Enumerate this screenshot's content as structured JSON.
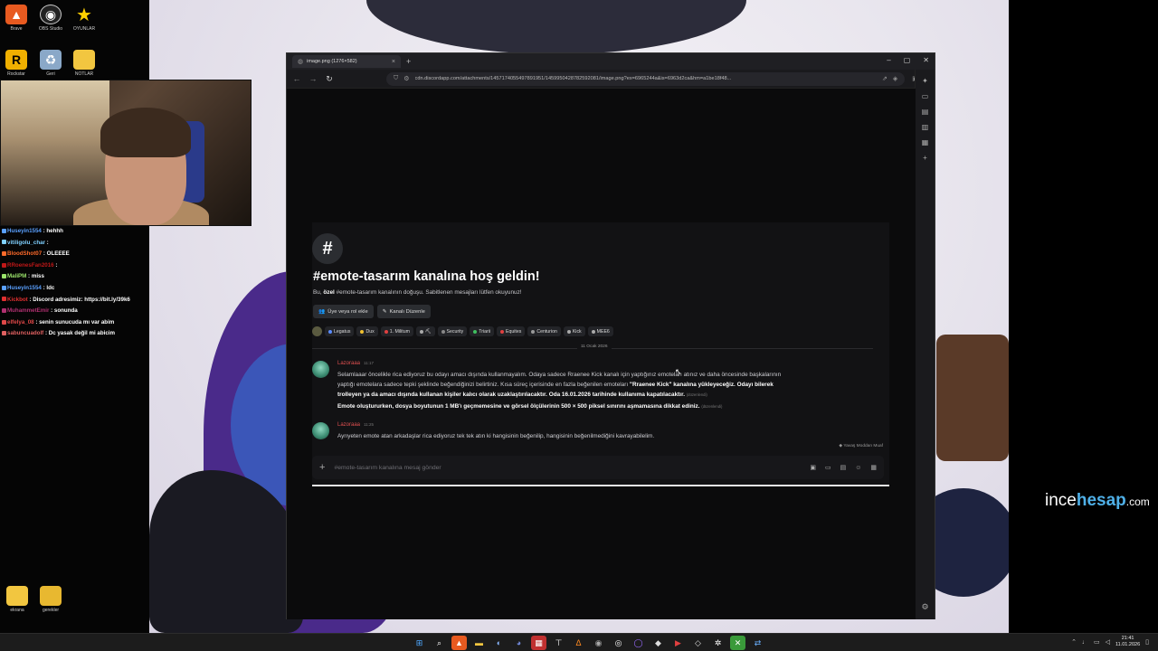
{
  "desktop": {
    "top_icons": [
      {
        "label": "Brave",
        "icon": "brave-lion-icon"
      },
      {
        "label": "OBS Studio",
        "icon": "obs-icon"
      },
      {
        "label": "OYUNLAR",
        "icon": "star-icon"
      },
      {
        "label": "Rockstar",
        "icon": "rockstar-icon"
      },
      {
        "label": "Geri",
        "icon": "recycle-bin-icon"
      },
      {
        "label": "NOTLAR",
        "icon": "folder-icon"
      }
    ],
    "bottom_icons": [
      {
        "label": "ekrana",
        "icon": "folder-icon"
      },
      {
        "label": "gerekler",
        "icon": "folder-icon"
      }
    ]
  },
  "chat": [
    {
      "user": "Huseyin1554",
      "text": "hehhh",
      "color": "#5aa0ff"
    },
    {
      "user": "vitiligolu_char",
      "text": "",
      "color": "#7fd0ff"
    },
    {
      "user": "BloodShot07",
      "text": "OLEEEE",
      "color": "#ff6a2a"
    },
    {
      "user": "RRoenesFan2016",
      "text": "",
      "color": "#c01818"
    },
    {
      "user": "MaliPM",
      "text": "miss",
      "color": "#9be36b"
    },
    {
      "user": "Huseyin1554",
      "text": "ldc",
      "color": "#5aa0ff"
    },
    {
      "user": "Kickbot",
      "text": "Discord adresimiz: https://bit.ly/39k6",
      "color": "#e03030"
    },
    {
      "user": "MuhammetEmir",
      "text": "sonunda",
      "color": "#b03070"
    },
    {
      "user": "elfelya_08",
      "text": "senin sunucuda mı var abim",
      "color": "#e04848"
    },
    {
      "user": "sabuncuadolf",
      "text": "Dc yasak değil mi abicim",
      "color": "#e06060"
    }
  ],
  "browser": {
    "tab_title": "image.png (1276×582)",
    "url": "cdn.discordapp.com/attachments/1457174055497891951/1459950428782592081/image.png?ex=6965244a&is=6963d2ca&hm=a1be18f48..."
  },
  "discord": {
    "title": "#emote-tasarım kanalına hoş geldin!",
    "subtitle_pre": "Bu, ",
    "subtitle_bold": "özel",
    "subtitle_post": " #emote-tasarım kanalının doğuşu. Sabitlenen mesajları lütfen okuyunuz!",
    "buttons": [
      "Üye veya rol ekle",
      "Kanalı Düzenle"
    ],
    "roles": [
      {
        "name": "Legatus",
        "color": "#5a8cff"
      },
      {
        "name": "Dux",
        "color": "#f0c030"
      },
      {
        "name": "1. Militum",
        "color": "#e04040"
      },
      {
        "name": "⛏",
        "color": "#aaaaaa"
      },
      {
        "name": "Security",
        "color": "#888888"
      },
      {
        "name": "Triarii",
        "color": "#3fbf5f"
      },
      {
        "name": "Equites",
        "color": "#e04040"
      },
      {
        "name": "Centurion",
        "color": "#999999"
      },
      {
        "name": "Kick",
        "color": "#aaaaaa"
      },
      {
        "name": "MEE6",
        "color": "#aaaaaa"
      }
    ],
    "date_divider": "11 Ocak 2026",
    "messages": [
      {
        "author": "Lazoraaa",
        "time": "11:17",
        "line1": "Selamlaaar öncelikle rica ediyoruz bu odayı amacı dışında kullanmayalım. Odaya sadece Rraenee Kick kanalı için yaptığınız emoteları atınız ve daha öncesinde başkalarının",
        "line2_pre": "yaptığı emotelara sadece tepki şeklinde beğendiğinizi belirtiniz. Kısa süreç içerisinde en fazla beğenilen emoteları ",
        "line2_bold": "\"Rraenee Kick\" kanalına yükleyeceğiz.",
        "line2_bold2": "  Odayı bilerek",
        "line3_bold": "trolleyen ya da amacı dışında kullanan kişiler kalıcı olarak uzaklaştırılacaktır.  Oda 16.01.2026 tarihinde kullanıma kapatılacaktır.",
        "line3_edited": "(düzenlendi)",
        "line4_bold": "Emote oluştururken, dosya boyutunun 1 MB'ı geçmemesine ve görsel ölçülerinin 500 × 500 piksel sınırını aşmamasına dikkat ediniz.",
        "line4_edited": "(düzenlendi)"
      },
      {
        "author": "Lazoraaa",
        "time": "11:25",
        "line1": "Ayrıyeten emote atan arkadaşlar rica ediyoruz tek tek atın ki hangisinin beğenilip, hangisinin beğenilmediğini kavrayabilelim."
      }
    ],
    "slowmode": "Yavaş Moddan Muaf",
    "composer_placeholder": "#emote-tasarım kanalına mesaj gönder"
  },
  "watermark": {
    "part1": "ince",
    "part2": "hesap",
    "part3": ".com"
  },
  "taskbar": {
    "time": "21:41",
    "date": "11.01.2026"
  }
}
